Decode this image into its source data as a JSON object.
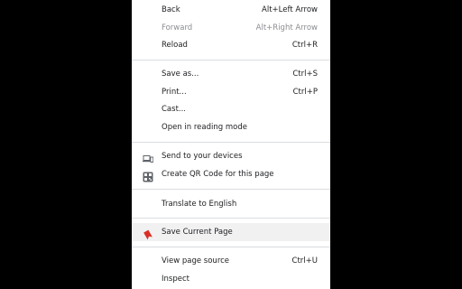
{
  "menu": {
    "back": {
      "label": "Back",
      "shortcut": "Alt+Left Arrow"
    },
    "forward": {
      "label": "Forward",
      "shortcut": "Alt+Right Arrow"
    },
    "reload": {
      "label": "Reload",
      "shortcut": "Ctrl+R"
    },
    "save_as": {
      "label": "Save as...",
      "shortcut": "Ctrl+S"
    },
    "print": {
      "label": "Print...",
      "shortcut": "Ctrl+P"
    },
    "cast": {
      "label": "Cast..."
    },
    "reading_mode": {
      "label": "Open in reading mode"
    },
    "send_devices": {
      "label": "Send to your devices",
      "icon": "laptop-phone-icon"
    },
    "qr_code": {
      "label": "Create QR Code for this page",
      "icon": "qr-code-icon"
    },
    "translate": {
      "label": "Translate to English"
    },
    "save_current": {
      "label": "Save Current Page",
      "icon": "bookmark-icon",
      "icon_color": "#d93025"
    },
    "view_source": {
      "label": "View page source",
      "shortcut": "Ctrl+U"
    },
    "inspect": {
      "label": "Inspect"
    }
  }
}
